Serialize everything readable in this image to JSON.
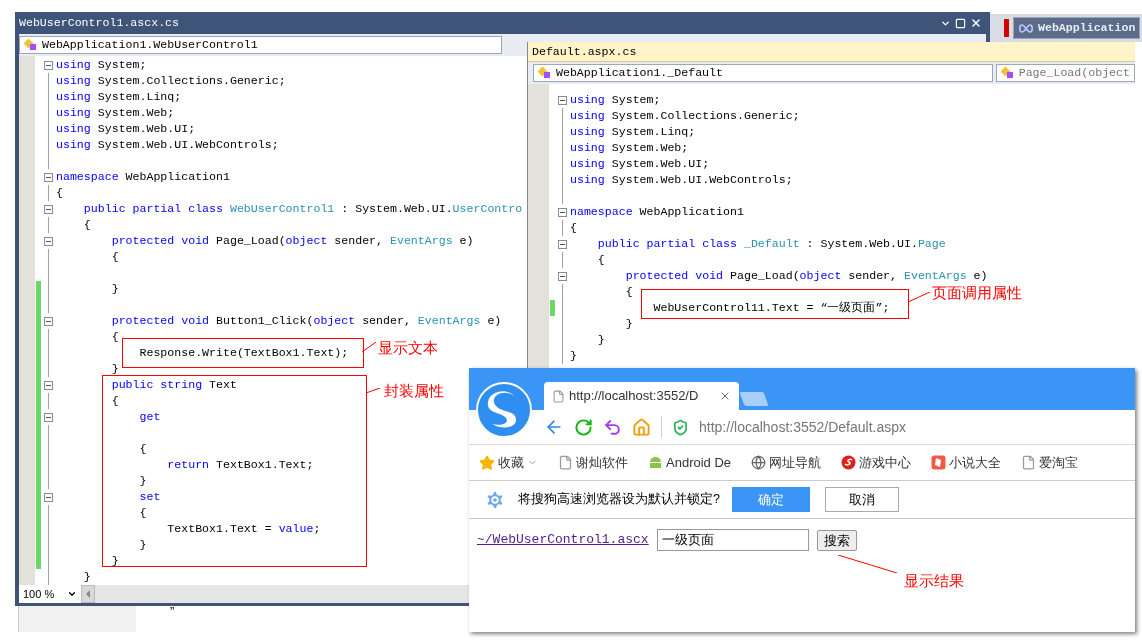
{
  "left_editor": {
    "title": "WebUserControl1.ascx.cs",
    "class_dropdown": "WebApplication1.WebUserControl1",
    "zoom": "100 %",
    "lines": [
      {
        "fold": true,
        "changed": false,
        "tokens": [
          {
            "kind": "kw",
            "text": "using"
          },
          {
            "kind": "plain",
            "text": " System;"
          }
        ]
      },
      {
        "fold": false,
        "changed": false,
        "tokens": [
          {
            "kind": "kw",
            "text": "using"
          },
          {
            "kind": "plain",
            "text": " System.Collections.Generic;"
          }
        ]
      },
      {
        "fold": false,
        "changed": false,
        "tokens": [
          {
            "kind": "kw",
            "text": "using"
          },
          {
            "kind": "plain",
            "text": " System.Linq;"
          }
        ]
      },
      {
        "fold": false,
        "changed": false,
        "tokens": [
          {
            "kind": "kw",
            "text": "using"
          },
          {
            "kind": "plain",
            "text": " System.Web;"
          }
        ]
      },
      {
        "fold": false,
        "changed": false,
        "tokens": [
          {
            "kind": "kw",
            "text": "using"
          },
          {
            "kind": "plain",
            "text": " System.Web.UI;"
          }
        ]
      },
      {
        "fold": false,
        "changed": false,
        "tokens": [
          {
            "kind": "kw",
            "text": "using"
          },
          {
            "kind": "plain",
            "text": " System.Web.UI.WebControls;"
          }
        ]
      },
      {
        "fold": false,
        "changed": false
      },
      {
        "fold": true,
        "changed": false,
        "tokens": [
          {
            "kind": "kw",
            "text": "namespace"
          },
          {
            "kind": "plain",
            "text": " WebApplication1"
          }
        ]
      },
      {
        "fold": false,
        "changed": false,
        "tokens": [
          {
            "kind": "plain",
            "text": "{"
          }
        ]
      },
      {
        "fold": true,
        "changed": false,
        "tokens": [
          {
            "kind": "kw",
            "text": "    public partial class"
          },
          {
            "kind": "type",
            "text": " WebUserControl1"
          },
          {
            "kind": "plain",
            "text": " : System.Web.UI."
          },
          {
            "kind": "type",
            "text": "UserContro"
          }
        ]
      },
      {
        "fold": false,
        "changed": false,
        "tokens": [
          {
            "kind": "plain",
            "text": "    {"
          }
        ]
      },
      {
        "fold": true,
        "changed": false,
        "tokens": [
          {
            "kind": "kw",
            "text": "        protected void"
          },
          {
            "kind": "plain",
            "text": " Page_Load("
          },
          {
            "kind": "kw",
            "text": "object"
          },
          {
            "kind": "plain",
            "text": " sender, "
          },
          {
            "kind": "type",
            "text": "EventArgs"
          },
          {
            "kind": "plain",
            "text": " e)"
          }
        ]
      },
      {
        "fold": false,
        "changed": false,
        "tokens": [
          {
            "kind": "plain",
            "text": "        {"
          }
        ]
      },
      {
        "fold": false,
        "changed": false
      },
      {
        "fold": false,
        "changed": true,
        "tokens": [
          {
            "kind": "plain",
            "text": "        }"
          }
        ]
      },
      {
        "fold": false,
        "changed": true
      },
      {
        "fold": true,
        "changed": true,
        "tokens": [
          {
            "kind": "kw",
            "text": "        protected void"
          },
          {
            "kind": "plain",
            "text": " Button1_Click("
          },
          {
            "kind": "kw",
            "text": "object"
          },
          {
            "kind": "plain",
            "text": " sender, "
          },
          {
            "kind": "type",
            "text": "EventArgs"
          },
          {
            "kind": "plain",
            "text": " e)"
          }
        ]
      },
      {
        "fold": false,
        "changed": true,
        "tokens": [
          {
            "kind": "plain",
            "text": "        {"
          }
        ]
      },
      {
        "fold": false,
        "changed": true,
        "tokens": [
          {
            "kind": "plain",
            "text": "            Response.Write(TextBox1.Text);"
          }
        ]
      },
      {
        "fold": false,
        "changed": true,
        "tokens": [
          {
            "kind": "plain",
            "text": "        }"
          }
        ]
      },
      {
        "fold": true,
        "changed": true,
        "tokens": [
          {
            "kind": "kw",
            "text": "        public string"
          },
          {
            "kind": "plain",
            "text": " Text"
          }
        ]
      },
      {
        "fold": false,
        "changed": true,
        "tokens": [
          {
            "kind": "plain",
            "text": "        {"
          }
        ]
      },
      {
        "fold": true,
        "changed": true,
        "tokens": [
          {
            "kind": "kw",
            "text": "            get"
          }
        ]
      },
      {
        "fold": false,
        "changed": true
      },
      {
        "fold": false,
        "changed": true,
        "tokens": [
          {
            "kind": "plain",
            "text": "            {"
          }
        ]
      },
      {
        "fold": false,
        "changed": true,
        "tokens": [
          {
            "kind": "kw",
            "text": "                return"
          },
          {
            "kind": "plain",
            "text": " TextBox1.Text;"
          }
        ]
      },
      {
        "fold": false,
        "changed": true,
        "tokens": [
          {
            "kind": "plain",
            "text": "            }"
          }
        ]
      },
      {
        "fold": true,
        "changed": true,
        "tokens": [
          {
            "kind": "kw",
            "text": "            set"
          }
        ]
      },
      {
        "fold": false,
        "changed": true,
        "tokens": [
          {
            "kind": "plain",
            "text": "            {"
          }
        ]
      },
      {
        "fold": false,
        "changed": true,
        "tokens": [
          {
            "kind": "plain",
            "text": "                TextBox1.Text = "
          },
          {
            "kind": "kw",
            "text": "value"
          },
          {
            "kind": "plain",
            "text": ";"
          }
        ]
      },
      {
        "fold": false,
        "changed": true,
        "tokens": [
          {
            "kind": "plain",
            "text": "            }"
          }
        ]
      },
      {
        "fold": false,
        "changed": true,
        "tokens": [
          {
            "kind": "plain",
            "text": "        }"
          }
        ]
      },
      {
        "fold": false,
        "changed": false,
        "tokens": [
          {
            "kind": "plain",
            "text": "    }"
          }
        ]
      }
    ]
  },
  "right_editor": {
    "title": "Default.aspx.cs",
    "class_dropdown": "WebApplication1._Default",
    "member_dropdown": "Page_Load(object",
    "lines": [
      {
        "fold": true,
        "changed": false,
        "tokens": [
          {
            "kind": "kw",
            "text": "using"
          },
          {
            "kind": "plain",
            "text": " System;"
          }
        ]
      },
      {
        "fold": false,
        "changed": false,
        "tokens": [
          {
            "kind": "kw",
            "text": "using"
          },
          {
            "kind": "plain",
            "text": " System.Collections.Generic;"
          }
        ]
      },
      {
        "fold": false,
        "changed": false,
        "tokens": [
          {
            "kind": "kw",
            "text": "using"
          },
          {
            "kind": "plain",
            "text": " System.Linq;"
          }
        ]
      },
      {
        "fold": false,
        "changed": false,
        "tokens": [
          {
            "kind": "kw",
            "text": "using"
          },
          {
            "kind": "plain",
            "text": " System.Web;"
          }
        ]
      },
      {
        "fold": false,
        "changed": false,
        "tokens": [
          {
            "kind": "kw",
            "text": "using"
          },
          {
            "kind": "plain",
            "text": " System.Web.UI;"
          }
        ]
      },
      {
        "fold": false,
        "changed": false,
        "tokens": [
          {
            "kind": "kw",
            "text": "using"
          },
          {
            "kind": "plain",
            "text": " System.Web.UI.WebControls;"
          }
        ]
      },
      {
        "fold": false,
        "changed": false
      },
      {
        "fold": true,
        "changed": false,
        "tokens": [
          {
            "kind": "kw",
            "text": "namespace"
          },
          {
            "kind": "plain",
            "text": " WebApplication1"
          }
        ]
      },
      {
        "fold": false,
        "changed": false,
        "tokens": [
          {
            "kind": "plain",
            "text": "{"
          }
        ]
      },
      {
        "fold": true,
        "changed": false,
        "tokens": [
          {
            "kind": "kw",
            "text": "    public partial class"
          },
          {
            "kind": "type",
            "text": " _Default"
          },
          {
            "kind": "plain",
            "text": " : System.Web.UI."
          },
          {
            "kind": "type",
            "text": "Page"
          }
        ]
      },
      {
        "fold": false,
        "changed": false,
        "tokens": [
          {
            "kind": "plain",
            "text": "    {"
          }
        ]
      },
      {
        "fold": true,
        "changed": false,
        "tokens": [
          {
            "kind": "kw",
            "text": "        protected void"
          },
          {
            "kind": "plain",
            "text": " Page_Load("
          },
          {
            "kind": "kw",
            "text": "object"
          },
          {
            "kind": "plain",
            "text": " sender, "
          },
          {
            "kind": "type",
            "text": "EventArgs"
          },
          {
            "kind": "plain",
            "text": " e)"
          }
        ]
      },
      {
        "fold": false,
        "changed": false,
        "tokens": [
          {
            "kind": "plain",
            "text": "        {"
          }
        ]
      },
      {
        "fold": false,
        "changed": true,
        "tokens": [
          {
            "kind": "plain",
            "text": "            WebUserControl11.Text = “一级页面”;"
          }
        ]
      },
      {
        "fold": false,
        "changed": false,
        "tokens": [
          {
            "kind": "plain",
            "text": "        }"
          }
        ]
      },
      {
        "fold": false,
        "changed": false,
        "tokens": [
          {
            "kind": "plain",
            "text": "    }"
          }
        ]
      },
      {
        "fold": false,
        "changed": false,
        "tokens": [
          {
            "kind": "plain",
            "text": "}"
          }
        ]
      }
    ]
  },
  "background_tab": {
    "title": "WebApplication"
  },
  "stray_text": "”",
  "browser": {
    "tab_title": "http://localhost:3552/D",
    "address": "http://localhost:3552/Default.aspx",
    "bookmarks": [
      {
        "kind": "star",
        "label": "收藏"
      },
      {
        "kind": "page",
        "label": "谢灿软件"
      },
      {
        "kind": "android",
        "label": "Android De"
      },
      {
        "kind": "globe",
        "label": "网址导航"
      },
      {
        "kind": "game",
        "label": "游戏中心"
      },
      {
        "kind": "novel",
        "label": "小说大全"
      },
      {
        "kind": "page",
        "label": "爱淘宝"
      }
    ],
    "prompt": {
      "text": "将搜狗高速浏览器设为默认并锁定?",
      "confirm": "确定",
      "cancel": "取消"
    },
    "content": {
      "link": "~/WebUserControl1.ascx",
      "textbox_value": "一级页面",
      "button": "搜索"
    }
  },
  "annotations": [
    {
      "text": "显示文本"
    },
    {
      "text": "封装属性"
    },
    {
      "text": "页面调用属性"
    },
    {
      "text": "显示结果"
    }
  ]
}
